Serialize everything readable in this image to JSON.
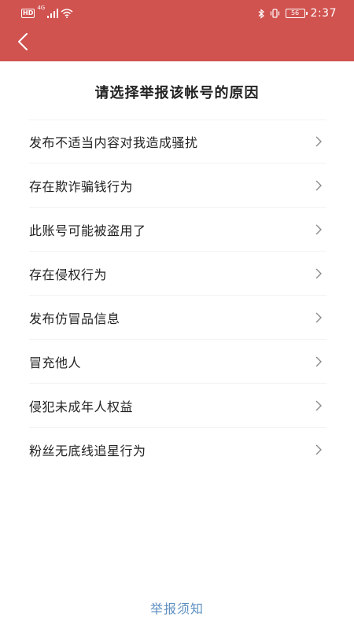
{
  "status_bar": {
    "hd_badge": "HD",
    "network": "4G",
    "battery": "56",
    "time": "2:37"
  },
  "header": {
    "back_icon": "chevron-left-icon",
    "background_color": "#d05350"
  },
  "page_title": "请选择举报该帐号的原因",
  "reasons": [
    {
      "label": "发布不适当内容对我造成骚扰"
    },
    {
      "label": "存在欺诈骗钱行为"
    },
    {
      "label": "此账号可能被盗用了"
    },
    {
      "label": "存在侵权行为"
    },
    {
      "label": "发布仿冒品信息"
    },
    {
      "label": "冒充他人"
    },
    {
      "label": "侵犯未成年人权益"
    },
    {
      "label": "粉丝无底线追星行为"
    }
  ],
  "footer": {
    "notice_link": "举报须知",
    "link_color": "#5e8fc1"
  }
}
